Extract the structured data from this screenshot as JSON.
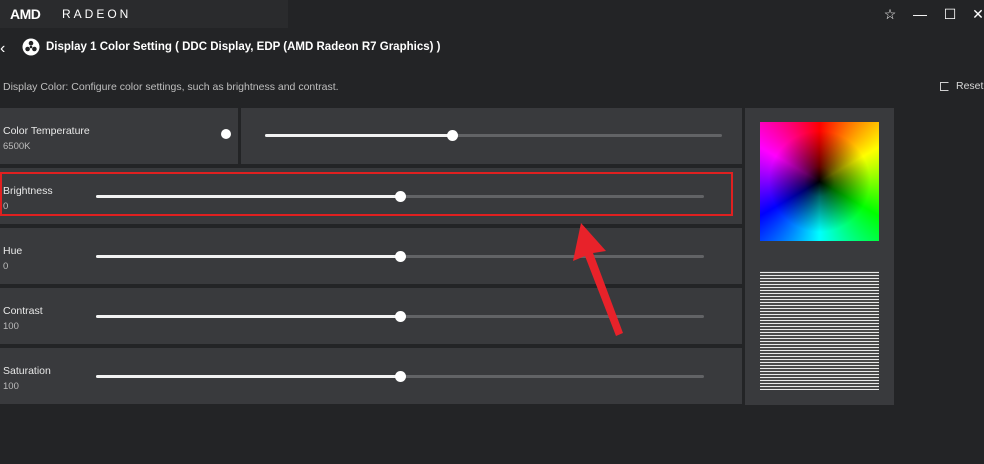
{
  "app": {
    "brand_amd": "AMD",
    "brand_radeon": "RADEON"
  },
  "window": {
    "buttons": {
      "favorite": "☆",
      "minimize": "—",
      "maximize": "☐",
      "close": "✕"
    }
  },
  "header": {
    "back": "‹",
    "title": "Display 1 Color Setting ( DDC Display, EDP (AMD Radeon R7 Graphics) )"
  },
  "description": "Display Color: Configure color settings, such as brightness and contrast.",
  "reset_label": "Reset",
  "settings": [
    {
      "label": "Color Temperature",
      "value": "6500K",
      "level": 0.41
    },
    {
      "label": "Brightness",
      "value": "0",
      "level": 0.5
    },
    {
      "label": "Hue",
      "value": "0",
      "level": 0.5
    },
    {
      "label": "Contrast",
      "value": "100",
      "level": 0.5
    },
    {
      "label": "Saturation",
      "value": "100",
      "level": 0.5
    }
  ],
  "colors": {
    "background": "#232426",
    "panel": "#393a3d",
    "highlight": "#e02020",
    "arrow": "#e8222a"
  }
}
